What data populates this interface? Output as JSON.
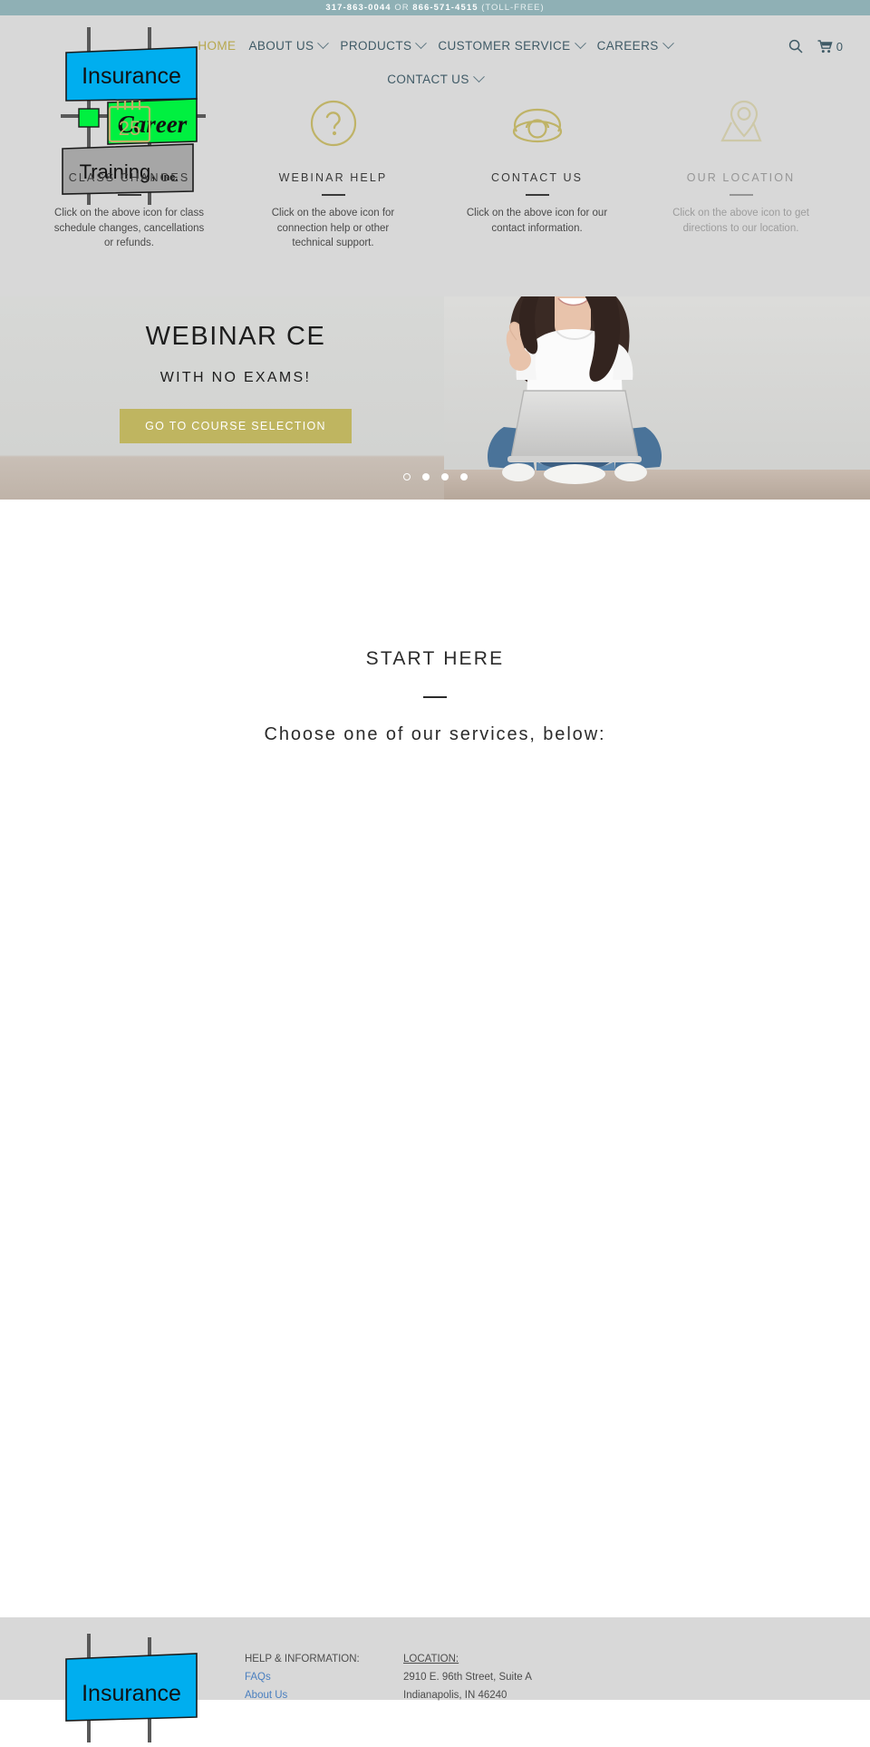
{
  "announcement": {
    "phone1": "317-863-0044",
    "or": " OR ",
    "phone2": "866-571-4515",
    "tollfree": " (TOLL-FREE)"
  },
  "logo": {
    "line1": "Insurance",
    "line2": "Career",
    "line3": "Training,",
    "line3_suffix": "Inc.",
    "colors": {
      "blue": "#00AEEF",
      "green": "#00F040",
      "gray": "#A6A6A6",
      "bar": "#595959"
    }
  },
  "nav": {
    "row1": [
      {
        "label": "HOME",
        "caret": false,
        "active": true
      },
      {
        "label": "ABOUT US",
        "caret": true,
        "active": false
      },
      {
        "label": "PRODUCTS",
        "caret": true,
        "active": false
      },
      {
        "label": "CUSTOMER SERVICE",
        "caret": true,
        "active": false
      },
      {
        "label": "CAREERS",
        "caret": true,
        "active": false
      }
    ],
    "row2": [
      {
        "label": "CONTACT US",
        "caret": true,
        "active": false
      }
    ],
    "search_icon": "search-icon",
    "cart_icon": "cart-icon",
    "cart_count": "0",
    "accent_color": "#b7a84f",
    "link_color": "#3f5a66"
  },
  "features": [
    {
      "icon": "calendar-25-icon",
      "title": "CLASS CHANGES",
      "desc": "Click on the above icon for class schedule changes, cancellations or refunds.",
      "faded": false
    },
    {
      "icon": "question-mark-circle-icon",
      "title": "WEBINAR HELP",
      "desc": "Click on the above icon for connection help or other technical support.",
      "faded": false
    },
    {
      "icon": "telephone-icon",
      "title": "CONTACT US",
      "desc": "Click on the above icon for our contact information.",
      "faded": false
    },
    {
      "icon": "map-pin-icon",
      "title": "OUR LOCATION",
      "desc": "Click on the above icon to get directions to our location.",
      "faded": true
    }
  ],
  "hero": {
    "title": "WEBINAR CE",
    "subtitle": "WITH NO EXAMS!",
    "button": "GO TO COURSE SELECTION",
    "button_color": "#bfb560",
    "dots": 4,
    "active_dot": 0,
    "photo_alt": "woman-with-laptop-photo"
  },
  "start": {
    "title": "START HERE",
    "subtitle": "Choose one of our services, below:"
  },
  "footer": {
    "help_heading": "HELP & INFORMATION:",
    "help_links": [
      "FAQs",
      "About Us"
    ],
    "location_heading": "LOCATION:",
    "location_lines": [
      "2910 E. 96th Street, Suite A",
      "Indianapolis, IN 46240"
    ]
  }
}
